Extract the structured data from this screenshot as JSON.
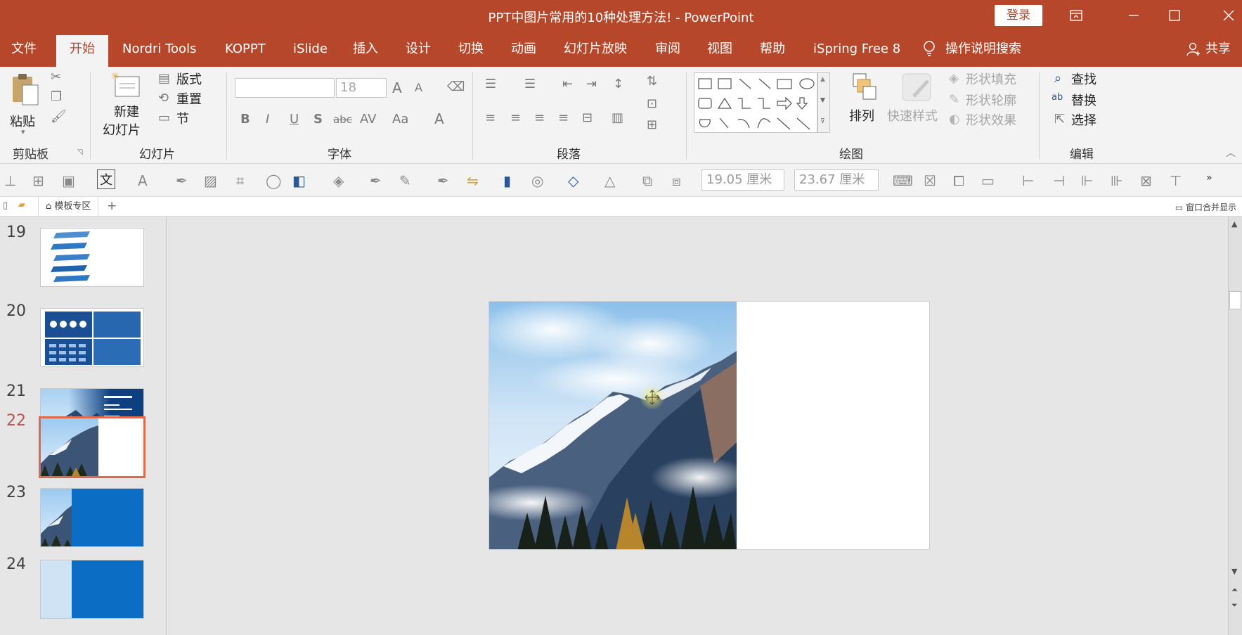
{
  "window": {
    "title": "PPT中图片常用的10种处理方法!  -  PowerPoint",
    "login_label": "登录"
  },
  "menu": {
    "items": [
      "文件",
      "开始",
      "Nordri Tools",
      "KOPPT",
      "iSlide",
      "插入",
      "设计",
      "切换",
      "动画",
      "幻灯片放映",
      "审阅",
      "视图",
      "帮助",
      "iSpring Free 8"
    ],
    "active": "开始",
    "search_label": "操作说明搜索",
    "share_label": "共享"
  },
  "ribbon": {
    "groups": {
      "clipboard": "剪贴板",
      "slides": "幻灯片",
      "font": "字体",
      "paragraph": "段落",
      "drawing": "绘图",
      "editing": "编辑"
    },
    "paste": "粘贴",
    "new_slide_line1": "新建",
    "new_slide_line2": "幻灯片",
    "layout": "版式",
    "reset": "重置",
    "section": "节",
    "font_size": "18",
    "arrange": "排列",
    "quick_styles": "快速样式",
    "shape_fill": "形状填充",
    "shape_outline": "形状轮廓",
    "shape_effects": "形状效果",
    "find": "查找",
    "replace": "替换",
    "select": "选择"
  },
  "quickbar": {
    "height_value": "19.05 厘米",
    "width_value": "23.67 厘米",
    "text_glyph": "文"
  },
  "tabstrip": {
    "template_tab": "模板专区",
    "merge_label": "窗口合并显示"
  },
  "thumbnails": {
    "numbers": [
      "19",
      "20",
      "21",
      "22",
      "23",
      "24"
    ],
    "selected": "22"
  },
  "colors": {
    "accent": "#b7472a",
    "selected_thumb_border": "#e0694b",
    "slide_blue": "#0b6ec4"
  }
}
